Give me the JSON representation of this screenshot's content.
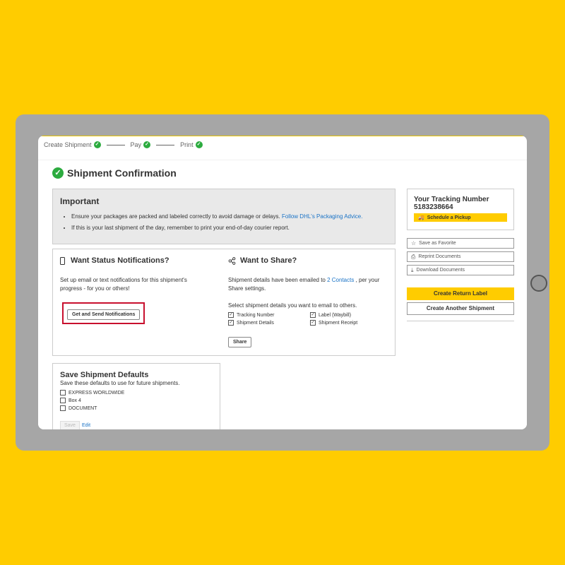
{
  "steps": [
    {
      "label": "Create Shipment"
    },
    {
      "label": "Pay"
    },
    {
      "label": "Print"
    }
  ],
  "page_title": "Shipment Confirmation",
  "important": {
    "title": "Important",
    "bullet1_text": "Ensure your packages are packed and labeled correctly to avoid damage or delays. ",
    "bullet1_link": "Follow DHL's Packaging Advice.",
    "bullet2_text": "If this is your last shipment of the day, remember to print your end-of-day courier report."
  },
  "notifications": {
    "title": "Want Status Notifications?",
    "description": "Set up email or text notifications for this shipment's progress - for you or others!",
    "button_label": "Get and Send Notifications"
  },
  "share": {
    "title": "Want to Share?",
    "emailed_text": "Shipment details have been emailed to ",
    "contacts_link": "2 Contacts",
    "emailed_suffix": " , per your Share settings.",
    "select_text": "Select shipment details you want to email to others.",
    "options": [
      {
        "label": "Tracking Number",
        "checked": true
      },
      {
        "label": "Label (Waybill)",
        "checked": true
      },
      {
        "label": "Shipment Details",
        "checked": true
      },
      {
        "label": "Shipment Receipt",
        "checked": true
      }
    ],
    "share_button": "Share"
  },
  "defaults": {
    "title": "Save Shipment Defaults",
    "description": "Save these defaults to use for future shipments.",
    "options": [
      {
        "label": "EXPRESS WORLDWIDE",
        "checked": false
      },
      {
        "label": "Box 4",
        "checked": false
      },
      {
        "label": "DOCUMENT",
        "checked": false
      }
    ],
    "save_label": "Save",
    "edit_label": "Edit"
  },
  "tracking": {
    "label": "Your Tracking Number",
    "number": "5183238664",
    "pickup_button": "Schedule a Pickup"
  },
  "side_actions": {
    "favorite": "Save as Favorite",
    "reprint": "Reprint Documents",
    "download": "Download Documents",
    "return_label": "Create Return Label",
    "another_shipment": "Create Another Shipment"
  },
  "icons": {
    "check": "check-circle-icon",
    "phone": "phone-icon",
    "share": "share-icon",
    "star": "star-icon",
    "printer": "printer-icon",
    "download": "download-icon",
    "truck": "truck-icon"
  },
  "colors": {
    "brand_yellow": "#FFCC00",
    "success_green": "#2CAB3F",
    "link_blue": "#1A73C6",
    "highlight_red": "#C8102E"
  }
}
